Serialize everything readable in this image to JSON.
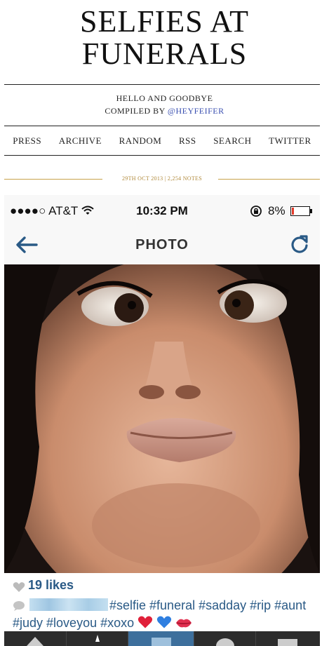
{
  "blog": {
    "title": "SELFIES AT FUNERALS",
    "tagline": "HELLO AND GOODBYE",
    "compiled_prefix": "COMPILED BY",
    "handle": "@HEYFEIFER"
  },
  "nav": {
    "items": [
      "PRESS",
      "ARCHIVE",
      "RANDOM",
      "RSS",
      "SEARCH",
      "TWITTER"
    ]
  },
  "post": {
    "meta": "29TH OCT 2013 | 2,254 NOTES"
  },
  "phone": {
    "carrier": "●●●●○ AT&T",
    "time": "10:32 PM",
    "battery": "8%",
    "screen_title": "PHOTO",
    "likes": "19 likes",
    "hashtags": "#selfie #funeral #sadday #rip #aunt #judy #loveyou #xoxo",
    "accent": "#2a5a86",
    "icons": [
      "wifi-icon",
      "lock-rotation-icon",
      "battery-icon",
      "back-arrow-icon",
      "refresh-icon",
      "heart-icon",
      "comment-icon",
      "red-heart-emoji",
      "blue-heart-emoji",
      "lips-emoji"
    ]
  }
}
